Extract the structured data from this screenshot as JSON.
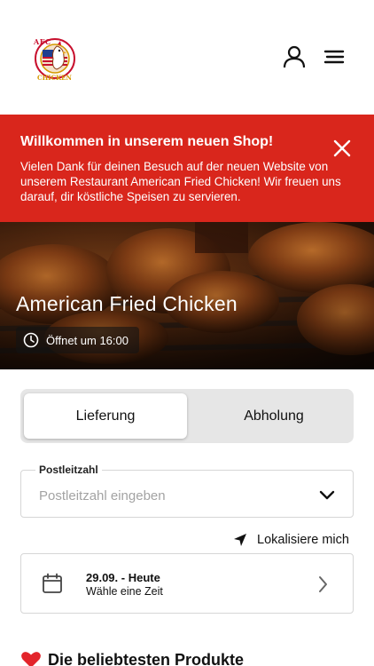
{
  "header": {
    "logo": {
      "brand": "AFC",
      "subtitle": "CHICKEN"
    },
    "user_icon": "user-icon",
    "menu_icon": "hamburger-menu-icon"
  },
  "banner": {
    "title": "Willkommen in unserem neuen Shop!",
    "text": "Vielen Dank für deinen Besuch auf der neuen Website von unserem Restaurant American Fried Chicken! Wir freuen uns darauf, dir köstliche Speisen zu servieren.",
    "close_icon": "close-icon",
    "color": "#d9261c"
  },
  "hero": {
    "title": "American Fried Chicken",
    "opening": "Öffnet um 16:00",
    "clock_icon": "clock-icon"
  },
  "order_mode": {
    "options": [
      "Lieferung",
      "Abholung"
    ],
    "selected": "Lieferung"
  },
  "postal": {
    "label": "Postleitzahl",
    "value": "",
    "placeholder": "Postleitzahl eingeben"
  },
  "locate": {
    "label": "Lokalisiere mich",
    "icon": "location-arrow-icon"
  },
  "date": {
    "main": "29.09. - Heute",
    "sub": "Wähle eine Zeit",
    "icon": "calendar-icon"
  },
  "popular": {
    "title": "Die beliebtesten Produkte",
    "icon": "heart-icon"
  }
}
